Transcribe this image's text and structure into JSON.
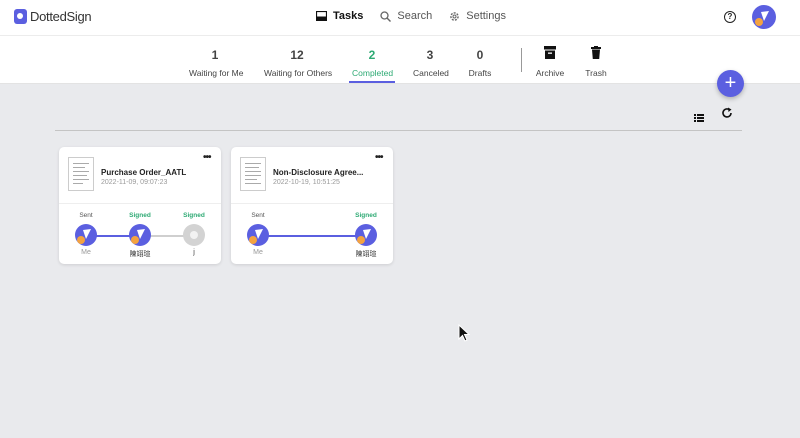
{
  "app": {
    "logo_text": "DottedSign",
    "brand_color": "#5b5fe0",
    "accent_color": "#2eaa74"
  },
  "nav": {
    "tasks": {
      "label": "Tasks",
      "icon": "inbox-icon"
    },
    "search": {
      "label": "Search",
      "icon": "search-icon"
    },
    "settings": {
      "label": "Settings",
      "icon": "gear-icon"
    },
    "help_icon": "?"
  },
  "tabs": [
    {
      "count": "1",
      "label": "Waiting for Me"
    },
    {
      "count": "12",
      "label": "Waiting for Others"
    },
    {
      "count": "2",
      "label": "Completed",
      "active": true
    },
    {
      "count": "3",
      "label": "Canceled"
    },
    {
      "count": "0",
      "label": "Drafts"
    }
  ],
  "folders": [
    {
      "label": "Archive",
      "icon": "archive-icon"
    },
    {
      "label": "Trash",
      "icon": "trash-icon"
    }
  ],
  "fab_label": "+",
  "documents": [
    {
      "title": "Purchase Order_AATL",
      "date": "2022-11-09, 09:07:23",
      "more": "•••",
      "steps": [
        {
          "status": "Sent",
          "name": "Me"
        },
        {
          "status": "Signed",
          "name": "陳翊瑄"
        },
        {
          "status": "Signed",
          "name": "j"
        }
      ]
    },
    {
      "title": "Non-Disclosure Agree...",
      "date": "2022-10-19, 10:51:25",
      "more": "•••",
      "steps": [
        {
          "status": "Sent",
          "name": "Me"
        },
        {
          "status": "Signed",
          "name": "陳翊瑄"
        }
      ]
    }
  ]
}
